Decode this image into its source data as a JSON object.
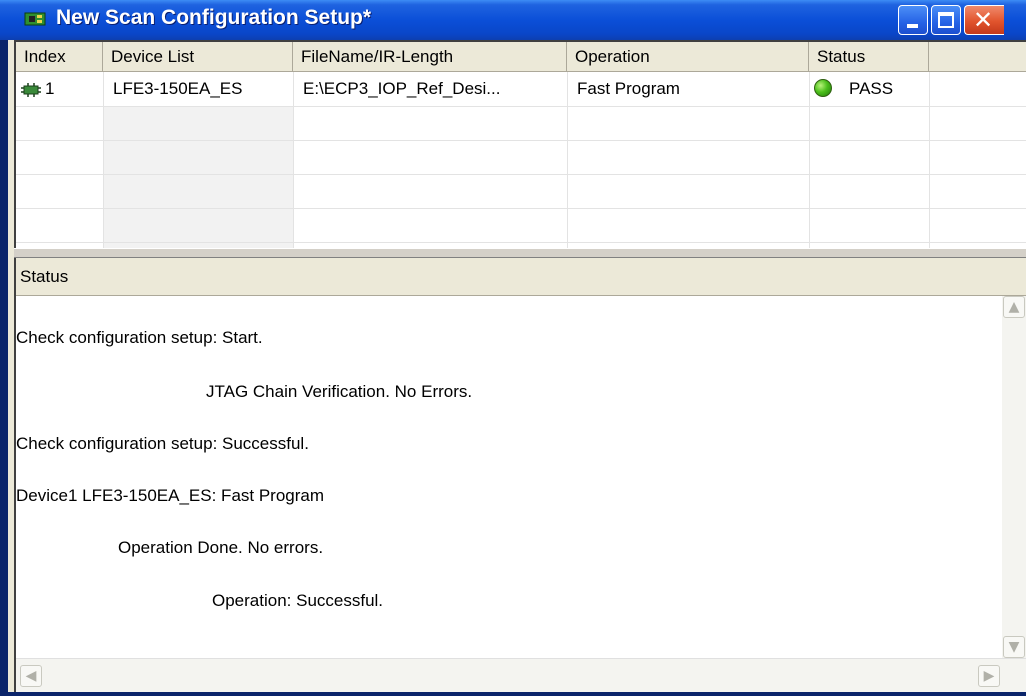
{
  "window": {
    "title": "New Scan Configuration Setup*",
    "title_icon": "chip-board-icon",
    "controls": {
      "minimize": "minimize-icon",
      "maximize": "maximize-icon",
      "close": "close-icon"
    },
    "colors": {
      "titlebar": "#0b4fd8",
      "close_button": "#e1542d",
      "pass_indicator": "#4cbf1c"
    }
  },
  "device_table": {
    "columns": [
      "Index",
      "Device List",
      "FileName/IR-Length",
      "Operation",
      "Status"
    ],
    "rows": [
      {
        "index": "1",
        "device": "LFE3-150EA_ES",
        "filename": "E:\\ECP3_IOP_Ref_Desi...",
        "operation": "Fast Program",
        "status": "PASS",
        "row_icon": "device-chip-icon",
        "status_icon": "green-status-dot-icon"
      }
    ]
  },
  "status_panel": {
    "title": "Status",
    "lines": [
      "Check configuration setup: Start.",
      "JTAG Chain Verification. No Errors.",
      "Check configuration setup: Successful.",
      "Device1 LFE3-150EA_ES: Fast Program",
      "Operation Done. No errors.",
      "Operation: Successful."
    ],
    "scroll_icons": {
      "up": "scroll-up-arrow-icon",
      "down": "scroll-down-arrow-icon",
      "left": "scroll-left-arrow-icon",
      "right": "scroll-right-arrow-icon"
    }
  }
}
